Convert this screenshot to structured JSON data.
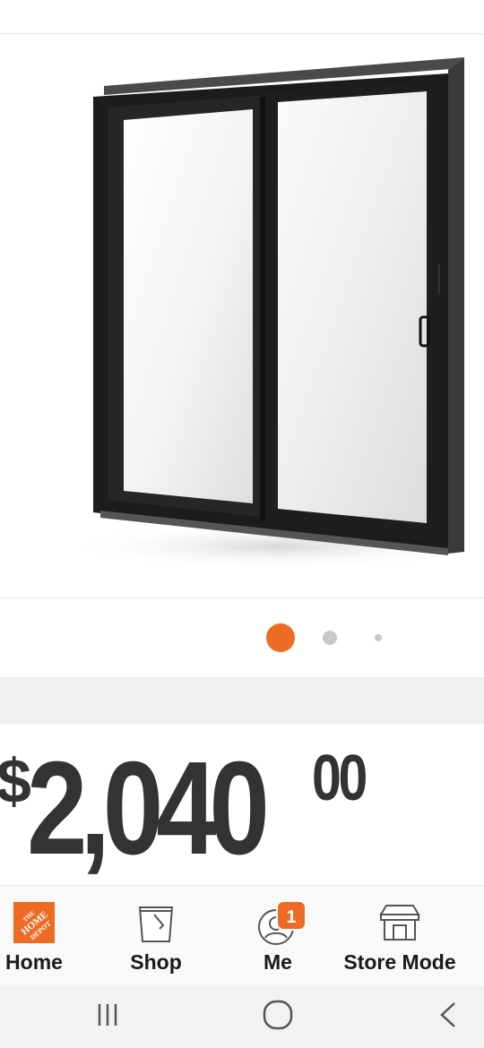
{
  "product": {
    "image_name": "sliding-patio-door-black-frame",
    "carousel": {
      "total": 3,
      "active_index": 0
    }
  },
  "price": {
    "symbol": "$",
    "dollars": "2,040",
    "cents": "00"
  },
  "bottom_nav": {
    "items": [
      {
        "label": "Home",
        "icon": "home-depot-logo-icon"
      },
      {
        "label": "Shop",
        "icon": "paint-bucket-icon"
      },
      {
        "label": "Me",
        "icon": "user-account-icon",
        "badge": "1"
      },
      {
        "label": "Store Mode",
        "icon": "store-icon"
      }
    ]
  },
  "system_nav": {
    "icons": [
      "recent-apps-icon",
      "home-circle-icon",
      "back-chevron-icon"
    ]
  },
  "colors": {
    "accent": "#ee6b23",
    "text": "#333333",
    "door_frame": "#1c1c1c"
  }
}
